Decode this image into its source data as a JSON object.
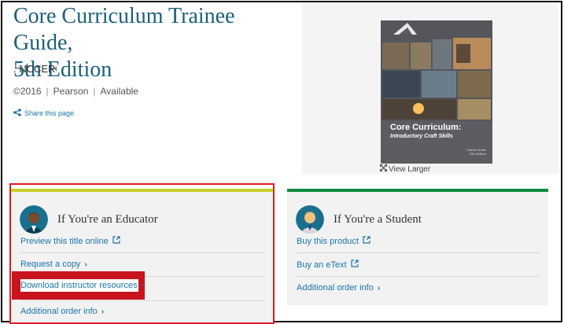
{
  "book": {
    "title_line1": "Core Curriculum Trainee Guide,",
    "title_line2": "5th Edition",
    "author": ". NCCER",
    "year": "©2016",
    "publisher": "Pearson",
    "availability": "Available",
    "share_label": "Share this page",
    "view_larger_label": "View Larger"
  },
  "cover": {
    "title": "Core Curriculum:",
    "subtitle": "Introductory Craft Skills",
    "edition_line1": "Trainee Guide",
    "edition_line2": "Fifth Edition"
  },
  "educator": {
    "heading": "If You're an Educator",
    "links": {
      "preview": "Preview this title online",
      "request_copy": "Request a copy",
      "download": "Download instructor resources",
      "order_info": "Additional order info"
    }
  },
  "student": {
    "heading": "If You're a Student",
    "links": {
      "buy_product": "Buy this product",
      "buy_etext": "Buy an eText",
      "order_info": "Additional order info"
    }
  },
  "colors": {
    "title": "#1c5f7a",
    "link": "#1b75a8",
    "educator_accent": "#c5d129",
    "student_accent": "#0e8a3d",
    "highlight": "#e11b22"
  }
}
